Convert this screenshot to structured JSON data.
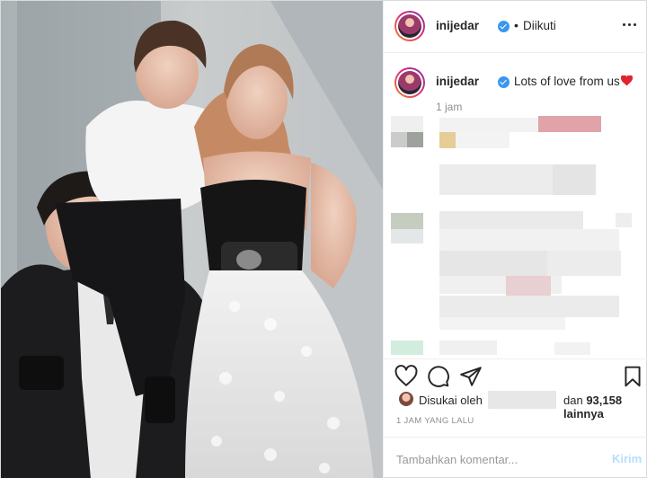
{
  "header": {
    "username": "inijedar",
    "separator": "•",
    "follow_state": "Diikuti",
    "more_icon": "more-dots-icon"
  },
  "caption": {
    "username": "inijedar",
    "text": "Lots of love from us",
    "emoji": "red-heart",
    "time_ago": "1 jam"
  },
  "actions": {
    "icons": [
      "heart-outline-icon",
      "comment-bubble-icon",
      "share-plane-icon",
      "bookmark-icon"
    ]
  },
  "likes": {
    "prefix": "Disukai oleh",
    "connector": "dan",
    "count": "93,158 lainnya"
  },
  "post_date": "1 JAM YANG LALU",
  "comment_box": {
    "placeholder": "Tambahkan komentar...",
    "send_label": "Kirim"
  },
  "colors": {
    "verified": "#3897f0",
    "send_disabled": "#b2dffc",
    "heart": "#ed4956",
    "border": "#dbdbdb"
  }
}
